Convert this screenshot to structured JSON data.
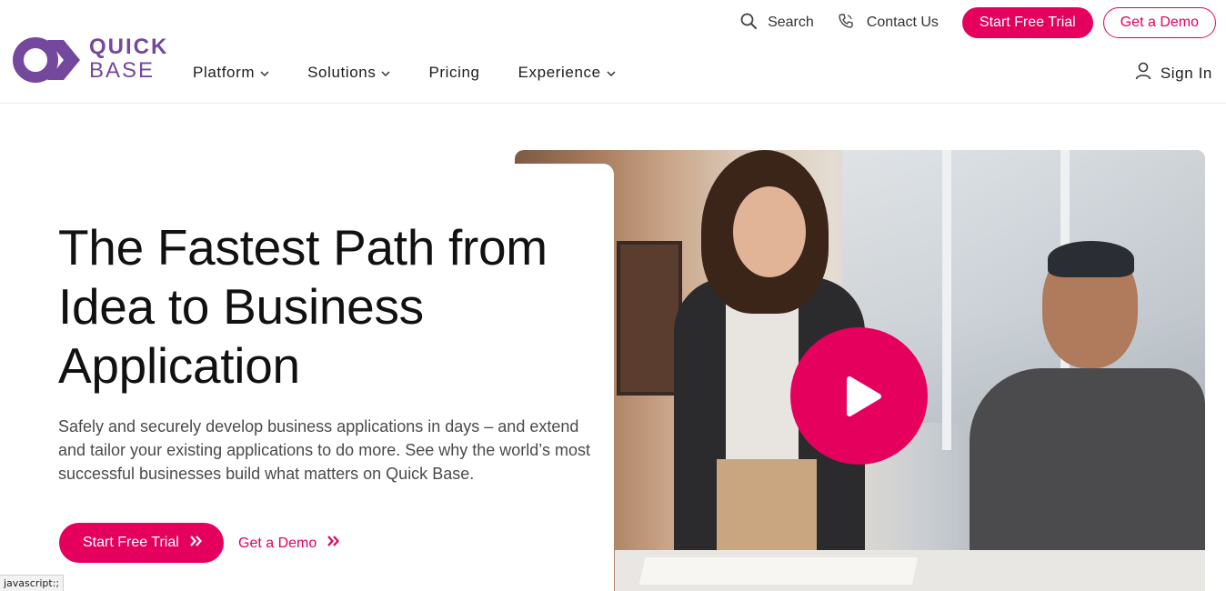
{
  "brand": {
    "word1": "QUICK",
    "word2": "BASE",
    "color": "#74489d"
  },
  "accent": "#e6005e",
  "utility_nav": {
    "search_label": "Search",
    "search_icon": "search-icon",
    "contact_label": "Contact Us",
    "contact_icon": "phone-icon",
    "trial_button": "Start Free Trial",
    "demo_button": "Get a Demo"
  },
  "main_nav": {
    "items": [
      {
        "label": "Platform",
        "has_dropdown": true
      },
      {
        "label": "Solutions",
        "has_dropdown": true
      },
      {
        "label": "Pricing",
        "has_dropdown": false
      },
      {
        "label": "Experience",
        "has_dropdown": true
      }
    ],
    "signin_label": "Sign In",
    "signin_icon": "user-icon"
  },
  "hero": {
    "title_line1": "The Fastest Path from",
    "title_line2": "Idea to Business",
    "title_line3": "Application",
    "subtitle": "Safely and securely develop business applications in days – and extend and tailor your existing applications to do more. See why the world’s most successful businesses build what matters on Quick Base.",
    "cta_trial": "Start Free Trial",
    "cta_demo": "Get a Demo",
    "video_icon": "play-icon"
  },
  "status_bar": {
    "text": "javascript:;"
  }
}
